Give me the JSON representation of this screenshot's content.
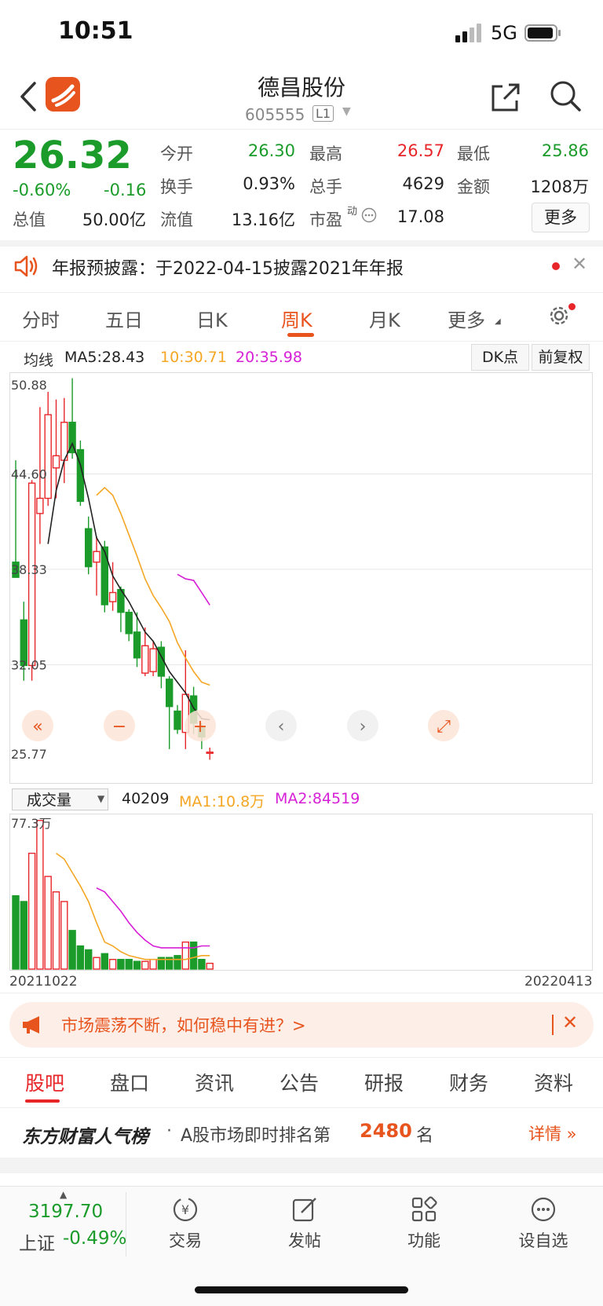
{
  "status_bar": {
    "time": "10:51",
    "network": "5G"
  },
  "header": {
    "stock_name": "德昌股份",
    "stock_code": "605555",
    "level": "L1"
  },
  "quote": {
    "price": "26.32",
    "change_pct": "-0.60%",
    "change": "-0.16",
    "rows": [
      [
        {
          "label": "今开",
          "value": "26.30",
          "color": "green"
        },
        {
          "label": "最高",
          "value": "26.57",
          "color": "red"
        },
        {
          "label": "最低",
          "value": "25.86",
          "color": "green"
        }
      ],
      [
        {
          "label": "换手",
          "value": "0.93%",
          "color": "black"
        },
        {
          "label": "总手",
          "value": "4629",
          "color": "black"
        },
        {
          "label": "金额",
          "value": "1208万",
          "color": "black"
        }
      ]
    ],
    "total_cap_label": "总值",
    "total_cap": "50.00亿",
    "float_cap_label": "流值",
    "float_cap": "13.16亿",
    "pe_label": "市盈",
    "pe_sup": "动",
    "pe": "17.08",
    "more": "更多"
  },
  "notice": {
    "text": "年报预披露：于2022-04-15披露2021年年报"
  },
  "chart_tabs": [
    {
      "label": "分时",
      "active": false
    },
    {
      "label": "五日",
      "active": false
    },
    {
      "label": "日K",
      "active": false
    },
    {
      "label": "周K",
      "active": true
    },
    {
      "label": "月K",
      "active": false
    },
    {
      "label": "更多",
      "active": false
    }
  ],
  "ma_legend": {
    "prefix": "均线",
    "ma5": "MA5:28.43",
    "ma10": "10:30.71",
    "ma20": "20:35.98",
    "dk_button": "DK点",
    "adjust_button": "前复权"
  },
  "colors": {
    "up": "#e8262a",
    "down": "#1a9b2a",
    "ma5": "#222222",
    "ma10": "#f5a623",
    "ma20": "#d61fd6",
    "accent": "#e8541e"
  },
  "chart_data": {
    "type": "candlestick",
    "period": "weekly",
    "y_ticks": [
      "50.88",
      "44.60",
      "38.33",
      "32.05",
      "25.77"
    ],
    "ylim": [
      25.77,
      50.88
    ],
    "candles": [
      {
        "o": 38.8,
        "h": 45.5,
        "l": 37.8,
        "c": 37.8
      },
      {
        "o": 35.0,
        "h": 36.2,
        "l": 31.0,
        "c": 32.0
      },
      {
        "o": 32.0,
        "h": 44.2,
        "l": 31.0,
        "c": 44.0
      },
      {
        "o": 42.0,
        "h": 49.0,
        "l": 40.0,
        "c": 43.0
      },
      {
        "o": 43.0,
        "h": 50.0,
        "l": 42.5,
        "c": 48.5
      },
      {
        "o": 45.0,
        "h": 49.5,
        "l": 43.0,
        "c": 45.8
      },
      {
        "o": 45.5,
        "h": 49.6,
        "l": 44.0,
        "c": 48.0
      },
      {
        "o": 48.0,
        "h": 50.9,
        "l": 45.6,
        "c": 46.0
      },
      {
        "o": 46.2,
        "h": 46.8,
        "l": 42.5,
        "c": 42.8
      },
      {
        "o": 41.0,
        "h": 41.8,
        "l": 38.0,
        "c": 38.5
      },
      {
        "o": 38.8,
        "h": 40.5,
        "l": 36.6,
        "c": 39.5
      },
      {
        "o": 39.8,
        "h": 40.2,
        "l": 35.5,
        "c": 36.0
      },
      {
        "o": 36.2,
        "h": 38.8,
        "l": 35.6,
        "c": 36.8
      },
      {
        "o": 37.0,
        "h": 37.2,
        "l": 34.2,
        "c": 35.5
      },
      {
        "o": 35.5,
        "h": 35.7,
        "l": 33.6,
        "c": 34.1
      },
      {
        "o": 34.2,
        "h": 35.5,
        "l": 31.9,
        "c": 32.5
      },
      {
        "o": 31.5,
        "h": 34.5,
        "l": 31.3,
        "c": 33.3
      },
      {
        "o": 31.6,
        "h": 33.6,
        "l": 31.3,
        "c": 33.1
      },
      {
        "o": 33.2,
        "h": 33.6,
        "l": 30.5,
        "c": 31.3
      },
      {
        "o": 31.1,
        "h": 31.3,
        "l": 26.5,
        "c": 29.3
      },
      {
        "o": 29.0,
        "h": 29.4,
        "l": 27.5,
        "c": 27.8
      },
      {
        "o": 27.6,
        "h": 33.0,
        "l": 26.5,
        "c": 30.1
      },
      {
        "o": 30.0,
        "h": 30.6,
        "l": 27.5,
        "c": 28.2
      },
      {
        "o": 28.0,
        "h": 28.2,
        "l": 26.5,
        "c": 27.3
      },
      {
        "o": 26.3,
        "h": 26.6,
        "l": 25.8,
        "c": 26.3
      }
    ],
    "ma5": [
      null,
      null,
      null,
      null,
      40.0,
      43.5,
      45.5,
      46.6,
      45.2,
      43.0,
      40.4,
      39.5,
      37.9,
      37.0,
      36.2,
      35.2,
      34.2,
      33.6,
      32.6,
      31.6,
      30.9,
      30.2,
      29.2,
      28.5,
      28.43
    ],
    "ma10": [
      null,
      null,
      null,
      null,
      null,
      null,
      null,
      null,
      null,
      null,
      43.2,
      43.7,
      43.2,
      42.0,
      40.6,
      39.2,
      37.7,
      36.6,
      35.8,
      34.9,
      33.5,
      32.5,
      31.6,
      30.9,
      30.71
    ],
    "ma20": [
      null,
      null,
      null,
      null,
      null,
      null,
      null,
      null,
      null,
      null,
      null,
      null,
      null,
      null,
      null,
      null,
      null,
      null,
      null,
      null,
      38.0,
      37.7,
      37.6,
      36.8,
      35.98
    ],
    "vol_ylim": [
      0,
      77.3
    ],
    "volume": [
      38,
      35,
      60,
      77,
      48,
      40,
      35,
      20,
      12,
      10,
      6,
      8,
      5,
      5,
      5,
      4,
      4,
      5,
      6,
      6,
      7,
      14,
      14,
      5,
      3
    ],
    "vol_ma1": [
      null,
      null,
      null,
      null,
      null,
      60,
      57,
      50,
      43,
      35,
      24,
      14,
      12,
      9,
      7,
      6,
      5,
      5,
      5,
      5,
      5,
      5,
      6,
      7,
      7
    ],
    "vol_ma2": [
      null,
      null,
      null,
      null,
      null,
      null,
      null,
      null,
      null,
      null,
      42,
      40,
      35,
      30,
      24,
      19,
      15,
      12,
      11,
      11,
      11,
      11,
      11,
      12,
      12
    ],
    "x_start": "20211022",
    "x_end": "20220413"
  },
  "volume_panel": {
    "selector": "成交量",
    "value": "40209",
    "ma1": "MA1:10.8万",
    "ma2": "MA2:84519",
    "y_top": "77.3万"
  },
  "promo": {
    "text": "市场震荡不断，如何稳中有进？>"
  },
  "info_tabs": [
    {
      "label": "股吧",
      "active": true
    },
    {
      "label": "盘口",
      "active": false
    },
    {
      "label": "资讯",
      "active": false
    },
    {
      "label": "公告",
      "active": false
    },
    {
      "label": "研报",
      "active": false
    },
    {
      "label": "财务",
      "active": false
    },
    {
      "label": "资料",
      "active": false
    }
  ],
  "ranking": {
    "brand": "东方财富人气榜",
    "dot": "·",
    "text": "A股市场即时排名第",
    "rank": "2480",
    "unit": "名",
    "detail": "详情 »"
  },
  "bottom_bar": {
    "index_value": "3197.70",
    "index_name": "上证",
    "index_change": "-0.49%",
    "items": [
      {
        "label": "交易",
        "icon": "trade-icon"
      },
      {
        "label": "发帖",
        "icon": "post-icon"
      },
      {
        "label": "功能",
        "icon": "apps-icon"
      },
      {
        "label": "设自选",
        "icon": "watchlist-icon"
      }
    ]
  }
}
